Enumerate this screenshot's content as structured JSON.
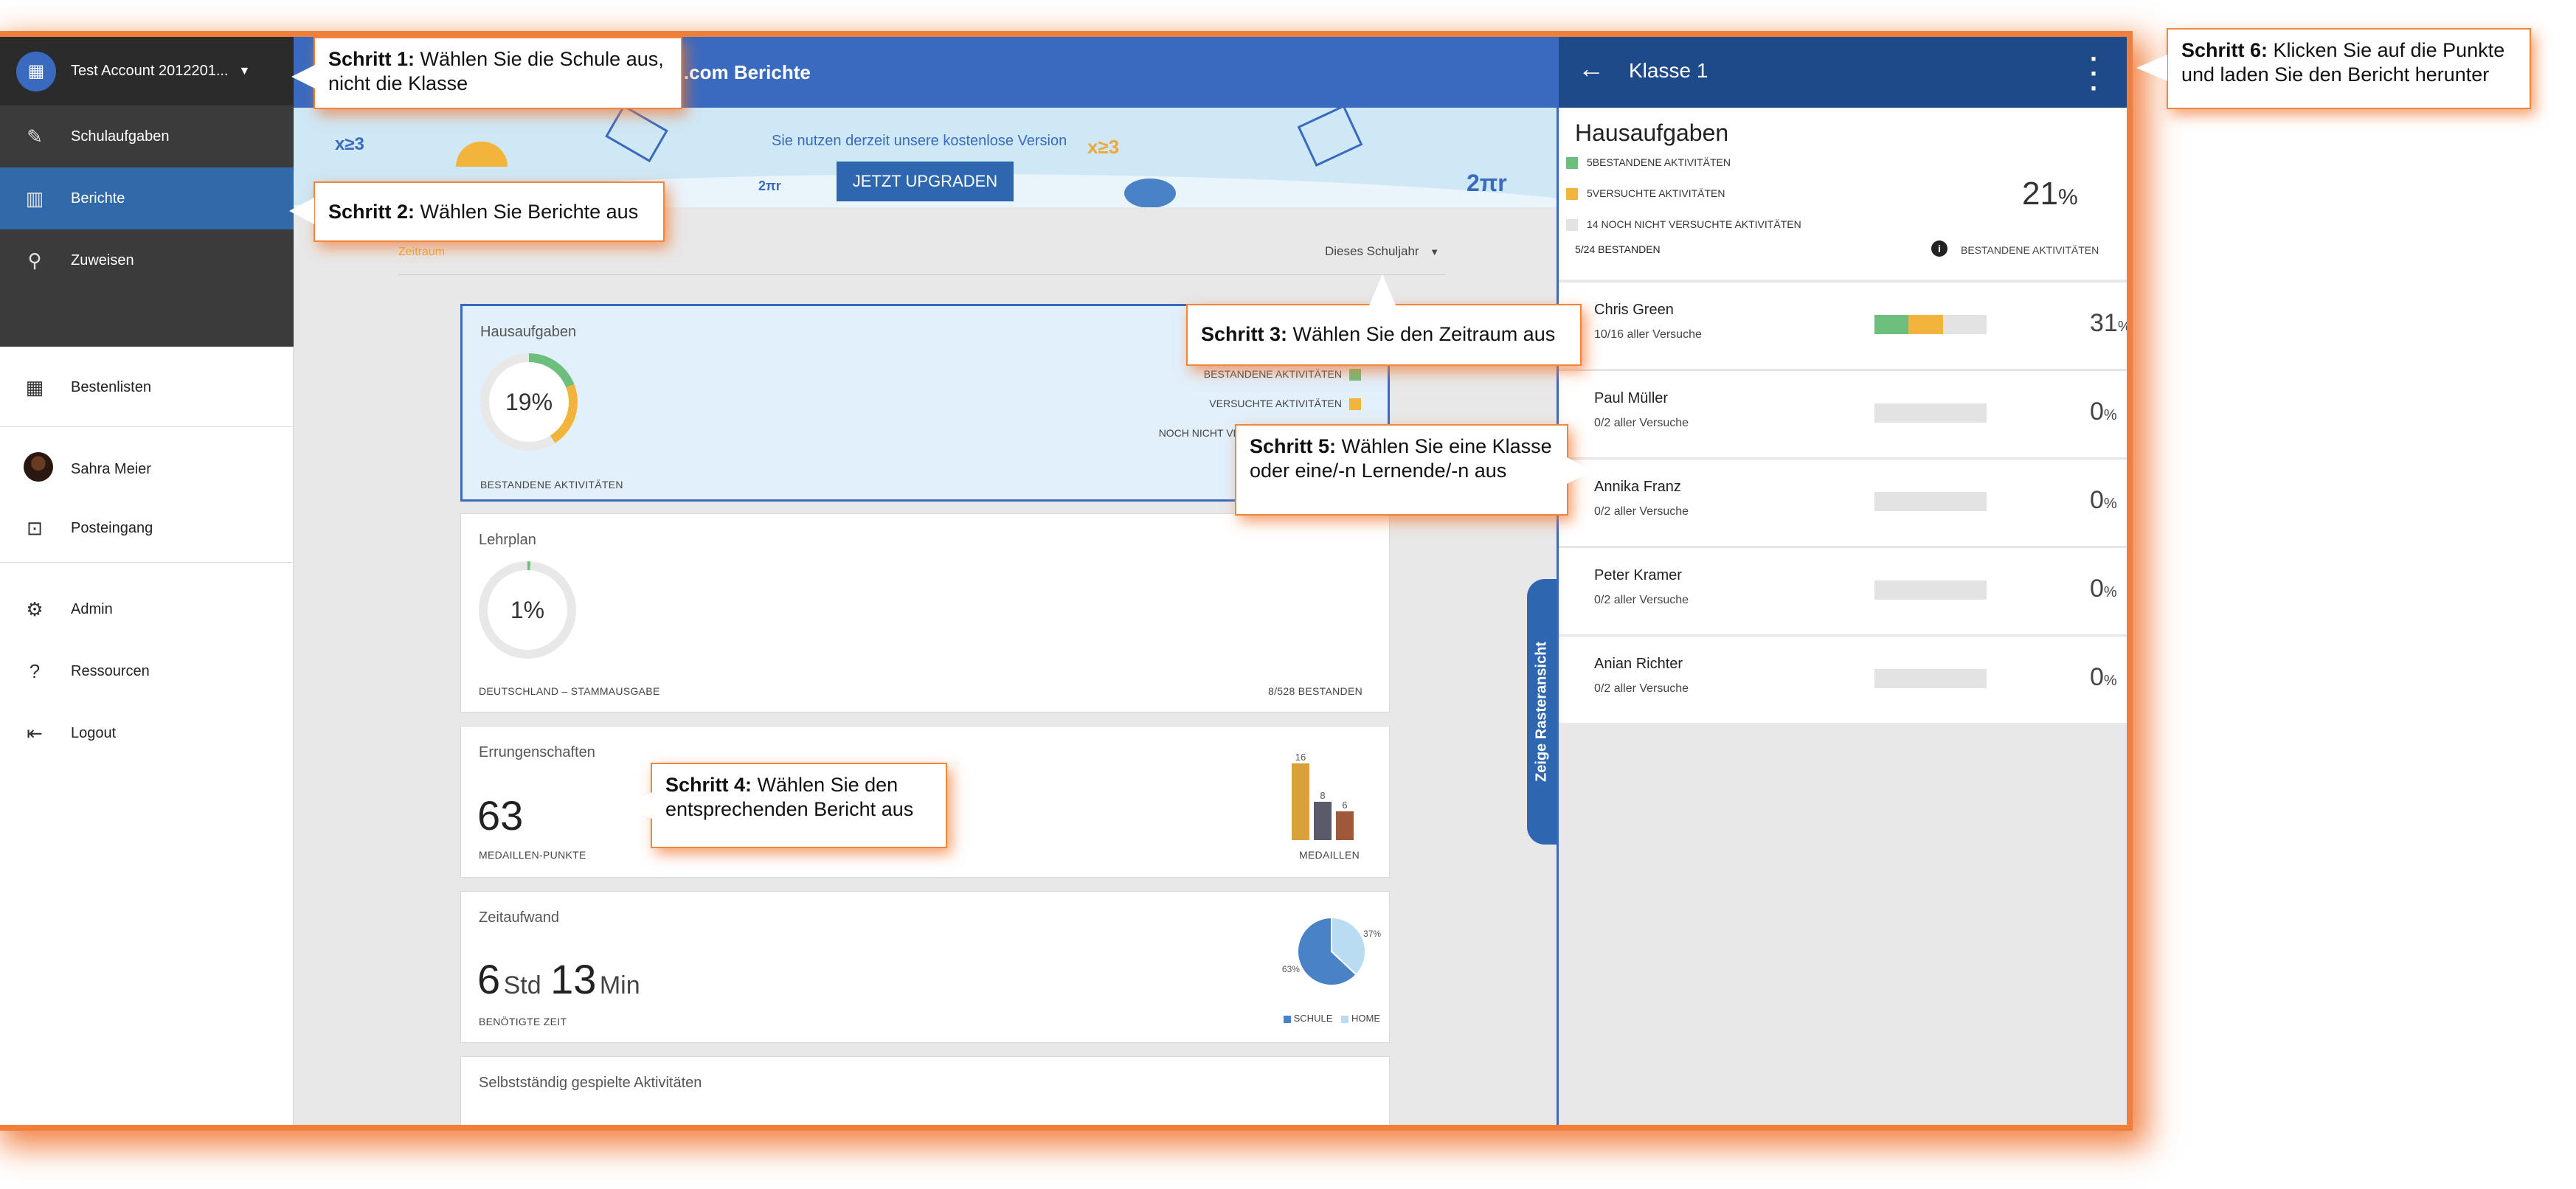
{
  "sidebar": {
    "account_name": "Test Account 2012201...",
    "top_items": [
      {
        "label": "Schulaufgaben",
        "icon": "edit-icon"
      },
      {
        "label": "Berichte",
        "icon": "bar-chart-icon"
      },
      {
        "label": "Zuweisen",
        "icon": "search-icon"
      }
    ],
    "bottom_items": [
      {
        "label": "Bestenlisten",
        "icon": "grid-icon"
      },
      {
        "label": "Sahra Meier",
        "icon": "avatar"
      },
      {
        "label": "Posteingang",
        "icon": "inbox-icon"
      },
      {
        "label": "Admin",
        "icon": "admin-gear-icon"
      },
      {
        "label": "Ressourcen",
        "icon": "help-icon"
      },
      {
        "label": "Logout",
        "icon": "logout-icon"
      }
    ]
  },
  "main": {
    "header_title": "ail.com Berichte",
    "banner_msg": "Sie nutzen derzeit unsere kostenlose Version",
    "upgrade_label": "JETZT UPGRADEN",
    "zeitraum_label": "Zeitraum",
    "schuljahr_label": "Dieses Schuljahr",
    "cards": {
      "hausaufgaben": {
        "title": "Hausaufgaben",
        "pct": "19%",
        "footer": "BESTANDENE AKTIVITÄTEN",
        "legend": [
          "BESTANDENE AKTIVITÄTEN",
          "VERSUCHTE AKTIVITÄTEN",
          "NOCH NICHT VER"
        ]
      },
      "lehrplan": {
        "title": "Lehrplan",
        "pct": "1%",
        "footer": "DEUTSCHLAND – STAMMAUSGABE",
        "right": "8/528 BESTANDEN"
      },
      "errungenschaften": {
        "title": "Errungenschaften",
        "value": "63",
        "footer": "MEDAILLEN-PUNKTE",
        "chart_label": "MEDAILLEN"
      },
      "zeitaufwand": {
        "title": "Zeitaufwand",
        "std": "6",
        "std_unit": "Std",
        "min": "13",
        "min_unit": "Min",
        "footer": "BENÖTIGTE ZEIT",
        "legend_schule": "SCHULE",
        "legend_home": "HOME"
      },
      "selbst": {
        "title": "Selbstständig gespielte Aktivitäten"
      }
    }
  },
  "chart_data": [
    {
      "type": "bar",
      "categories": [
        "",
        "",
        ""
      ],
      "values": [
        16,
        8,
        6
      ],
      "title": "",
      "xlabel": "MEDAILLEN",
      "colors": [
        "#d9a13a",
        "#5a5a6a",
        "#a0583a"
      ]
    },
    {
      "type": "pie",
      "categories": [
        "SCHULE",
        "HOME"
      ],
      "values": [
        63,
        37
      ],
      "labels": [
        "63%",
        "37%"
      ],
      "colors": [
        "#4a82c8",
        "#b9dcf3"
      ]
    }
  ],
  "panel": {
    "title": "Klasse 1",
    "section_title": "Hausaufgaben",
    "legend": [
      "5BESTANDENE AKTIVITÄTEN",
      "5VERSUCHTE AKTIVITÄTEN",
      "14 NOCH NICHT VERSUCHTE AKTIVITÄTEN"
    ],
    "pct": "21",
    "pct_unit": "%",
    "bestanden": "5/24 BESTANDEN",
    "info_label": "BESTANDENE AKTIVITÄTEN",
    "students": [
      {
        "name": "Chris Green",
        "versuche": "10/16 aller Versuche",
        "pct": "31",
        "unit": "%",
        "green": 0.3,
        "yellow": 0.31
      },
      {
        "name": "Paul Müller",
        "versuche": "0/2 aller Versuche",
        "pct": "0",
        "unit": "%",
        "green": 0,
        "yellow": 0
      },
      {
        "name": "Annika Franz",
        "versuche": "0/2 aller Versuche",
        "pct": "0",
        "unit": "%",
        "green": 0,
        "yellow": 0
      },
      {
        "name": "Peter Kramer",
        "versuche": "0/2 aller Versuche",
        "pct": "0",
        "unit": "%",
        "green": 0,
        "yellow": 0
      },
      {
        "name": "Anian Richter",
        "versuche": "0/2 aller Versuche",
        "pct": "0",
        "unit": "%",
        "green": 0,
        "yellow": 0
      }
    ],
    "grid_tab": "Zeige Rasteransicht"
  },
  "callouts": [
    {
      "bold": "Schritt 1:",
      "text": " Wählen Sie die Schule aus, nicht die Klasse"
    },
    {
      "bold": "Schritt 2:",
      "text": " Wählen Sie Berichte aus"
    },
    {
      "bold": "Schritt 3:",
      "text": " Wählen Sie den Zeitraum aus"
    },
    {
      "bold": "Schritt 4:",
      "text": " Wählen Sie den entsprechenden Bericht aus"
    },
    {
      "bold": "Schritt 5:",
      "text": " Wählen Sie eine Klasse oder eine/-n Lernende/-n aus"
    },
    {
      "bold": "Schritt 6:",
      "text": " Klicken Sie auf die Punkte und laden Sie den Bericht herunter"
    }
  ],
  "colors": {
    "accent": "#3a6ac0",
    "callout_border": "#f0853c",
    "green": "#6cbf7c",
    "yellow": "#f3b43c"
  }
}
